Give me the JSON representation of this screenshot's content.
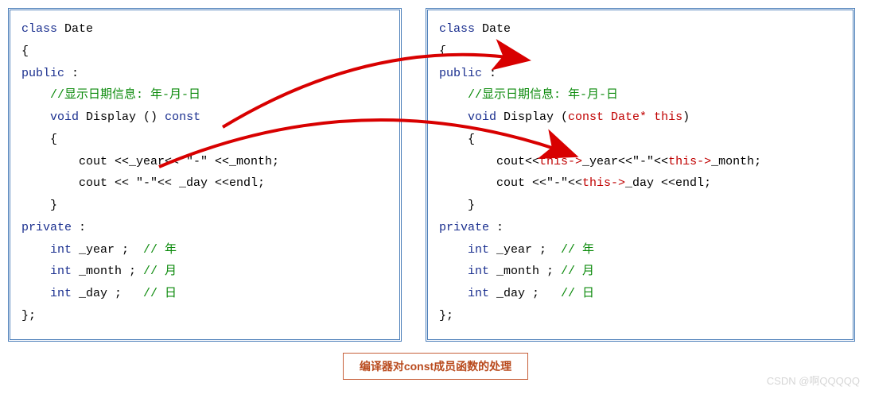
{
  "left": {
    "l1a": "class",
    "l1b": " Date",
    "l2": "{",
    "l3a": "public",
    "l3b": " :",
    "l4": "    //显示日期信息: 年-月-日",
    "l5a": "    ",
    "l5b": "void",
    "l5c": " Display () ",
    "l5d": "const",
    "l6": "    {",
    "l7": "        cout <<_year<< \"-\" <<_month;",
    "l8": "        cout << \"-\"<< _day <<endl;",
    "l9": "    }",
    "l10a": "private",
    "l10b": " :",
    "l11a": "    ",
    "l11b": "int",
    "l11c": " _year ;  ",
    "l11d": "// 年",
    "l12a": "    ",
    "l12b": "int",
    "l12c": " _month ; ",
    "l12d": "// 月",
    "l13a": "    ",
    "l13b": "int",
    "l13c": " _day ;   ",
    "l13d": "// 日",
    "l14": "};"
  },
  "right": {
    "l1a": "class",
    "l1b": " Date",
    "l2": "{",
    "l3a": "public",
    "l3b": " :",
    "l4": "    //显示日期信息: 年-月-日",
    "l5a": "    ",
    "l5b": "void",
    "l5c": " Display (",
    "l5d": "const Date* this",
    "l5e": ")",
    "l6": "    {",
    "l7a": "        cout<<",
    "l7b": "this->",
    "l7c": "_year<<\"-\"<<",
    "l7d": "this->",
    "l7e": "_month;",
    "l8a": "        cout <<\"-\"<<",
    "l8b": "this->",
    "l8c": "_day <<endl;",
    "l9": "    }",
    "l10a": "private",
    "l10b": " :",
    "l11a": "    ",
    "l11b": "int",
    "l11c": " _year ;  ",
    "l11d": "// 年",
    "l12a": "    ",
    "l12b": "int",
    "l12c": " _month ; ",
    "l12d": "// 月",
    "l13a": "    ",
    "l13b": "int",
    "l13c": " _day ;   ",
    "l13d": "// 日",
    "l14": "};"
  },
  "caption": "编译器对const成员函数的处理",
  "watermark": "CSDN @啊QQQQQ"
}
